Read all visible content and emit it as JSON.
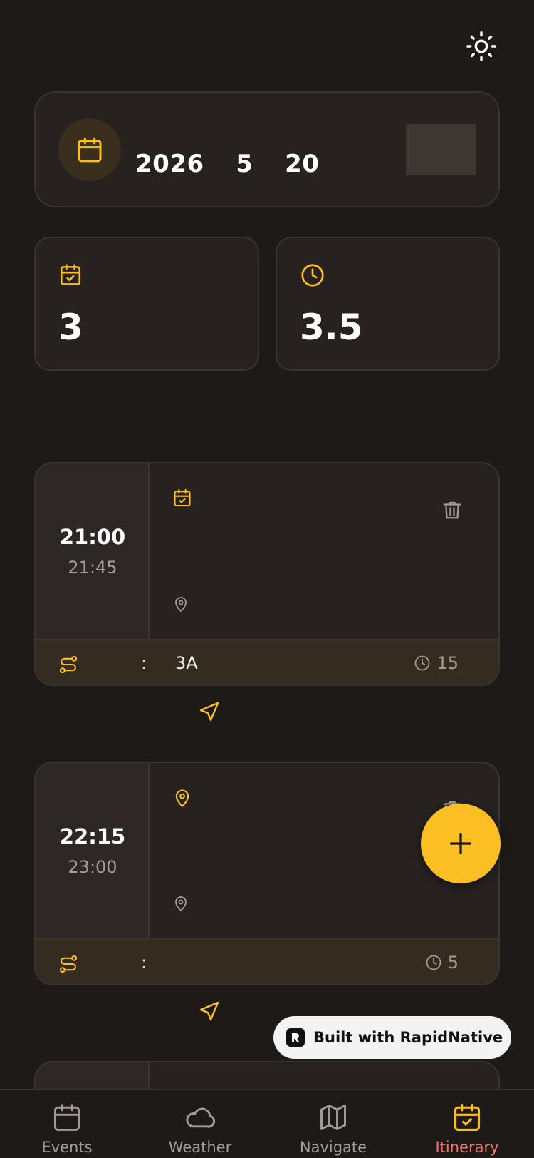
{
  "header": {
    "theme_toggle_icon": "sun-icon"
  },
  "date_card": {
    "icon": "calendar-icon",
    "date_text": "2026  5  20"
  },
  "stats": [
    {
      "icon": "calendar-check-icon",
      "value": "3"
    },
    {
      "icon": "clock-icon",
      "value": "3.5"
    }
  ],
  "itinerary": [
    {
      "start": "21:00",
      "end": "21:45",
      "type_icon": "calendar-check-icon",
      "colon": ":",
      "transit": "3A",
      "duration": "15"
    },
    {
      "start": "22:15",
      "end": "23:00",
      "type_icon": "map-pin-icon",
      "colon": ":",
      "transit": "",
      "duration": "5"
    }
  ],
  "badge": {
    "text": "Built with RapidNative"
  },
  "tabs": [
    {
      "label": "Events",
      "icon": "calendar-icon"
    },
    {
      "label": "Weather",
      "icon": "cloud-icon"
    },
    {
      "label": "Navigate",
      "icon": "map-icon"
    },
    {
      "label": "Itinerary",
      "icon": "calendar-check-icon",
      "active": true
    }
  ],
  "colors": {
    "accent": "#fbbf24",
    "background": "#1e1a18",
    "card": "#272220",
    "active_tab": "#f0746a"
  }
}
